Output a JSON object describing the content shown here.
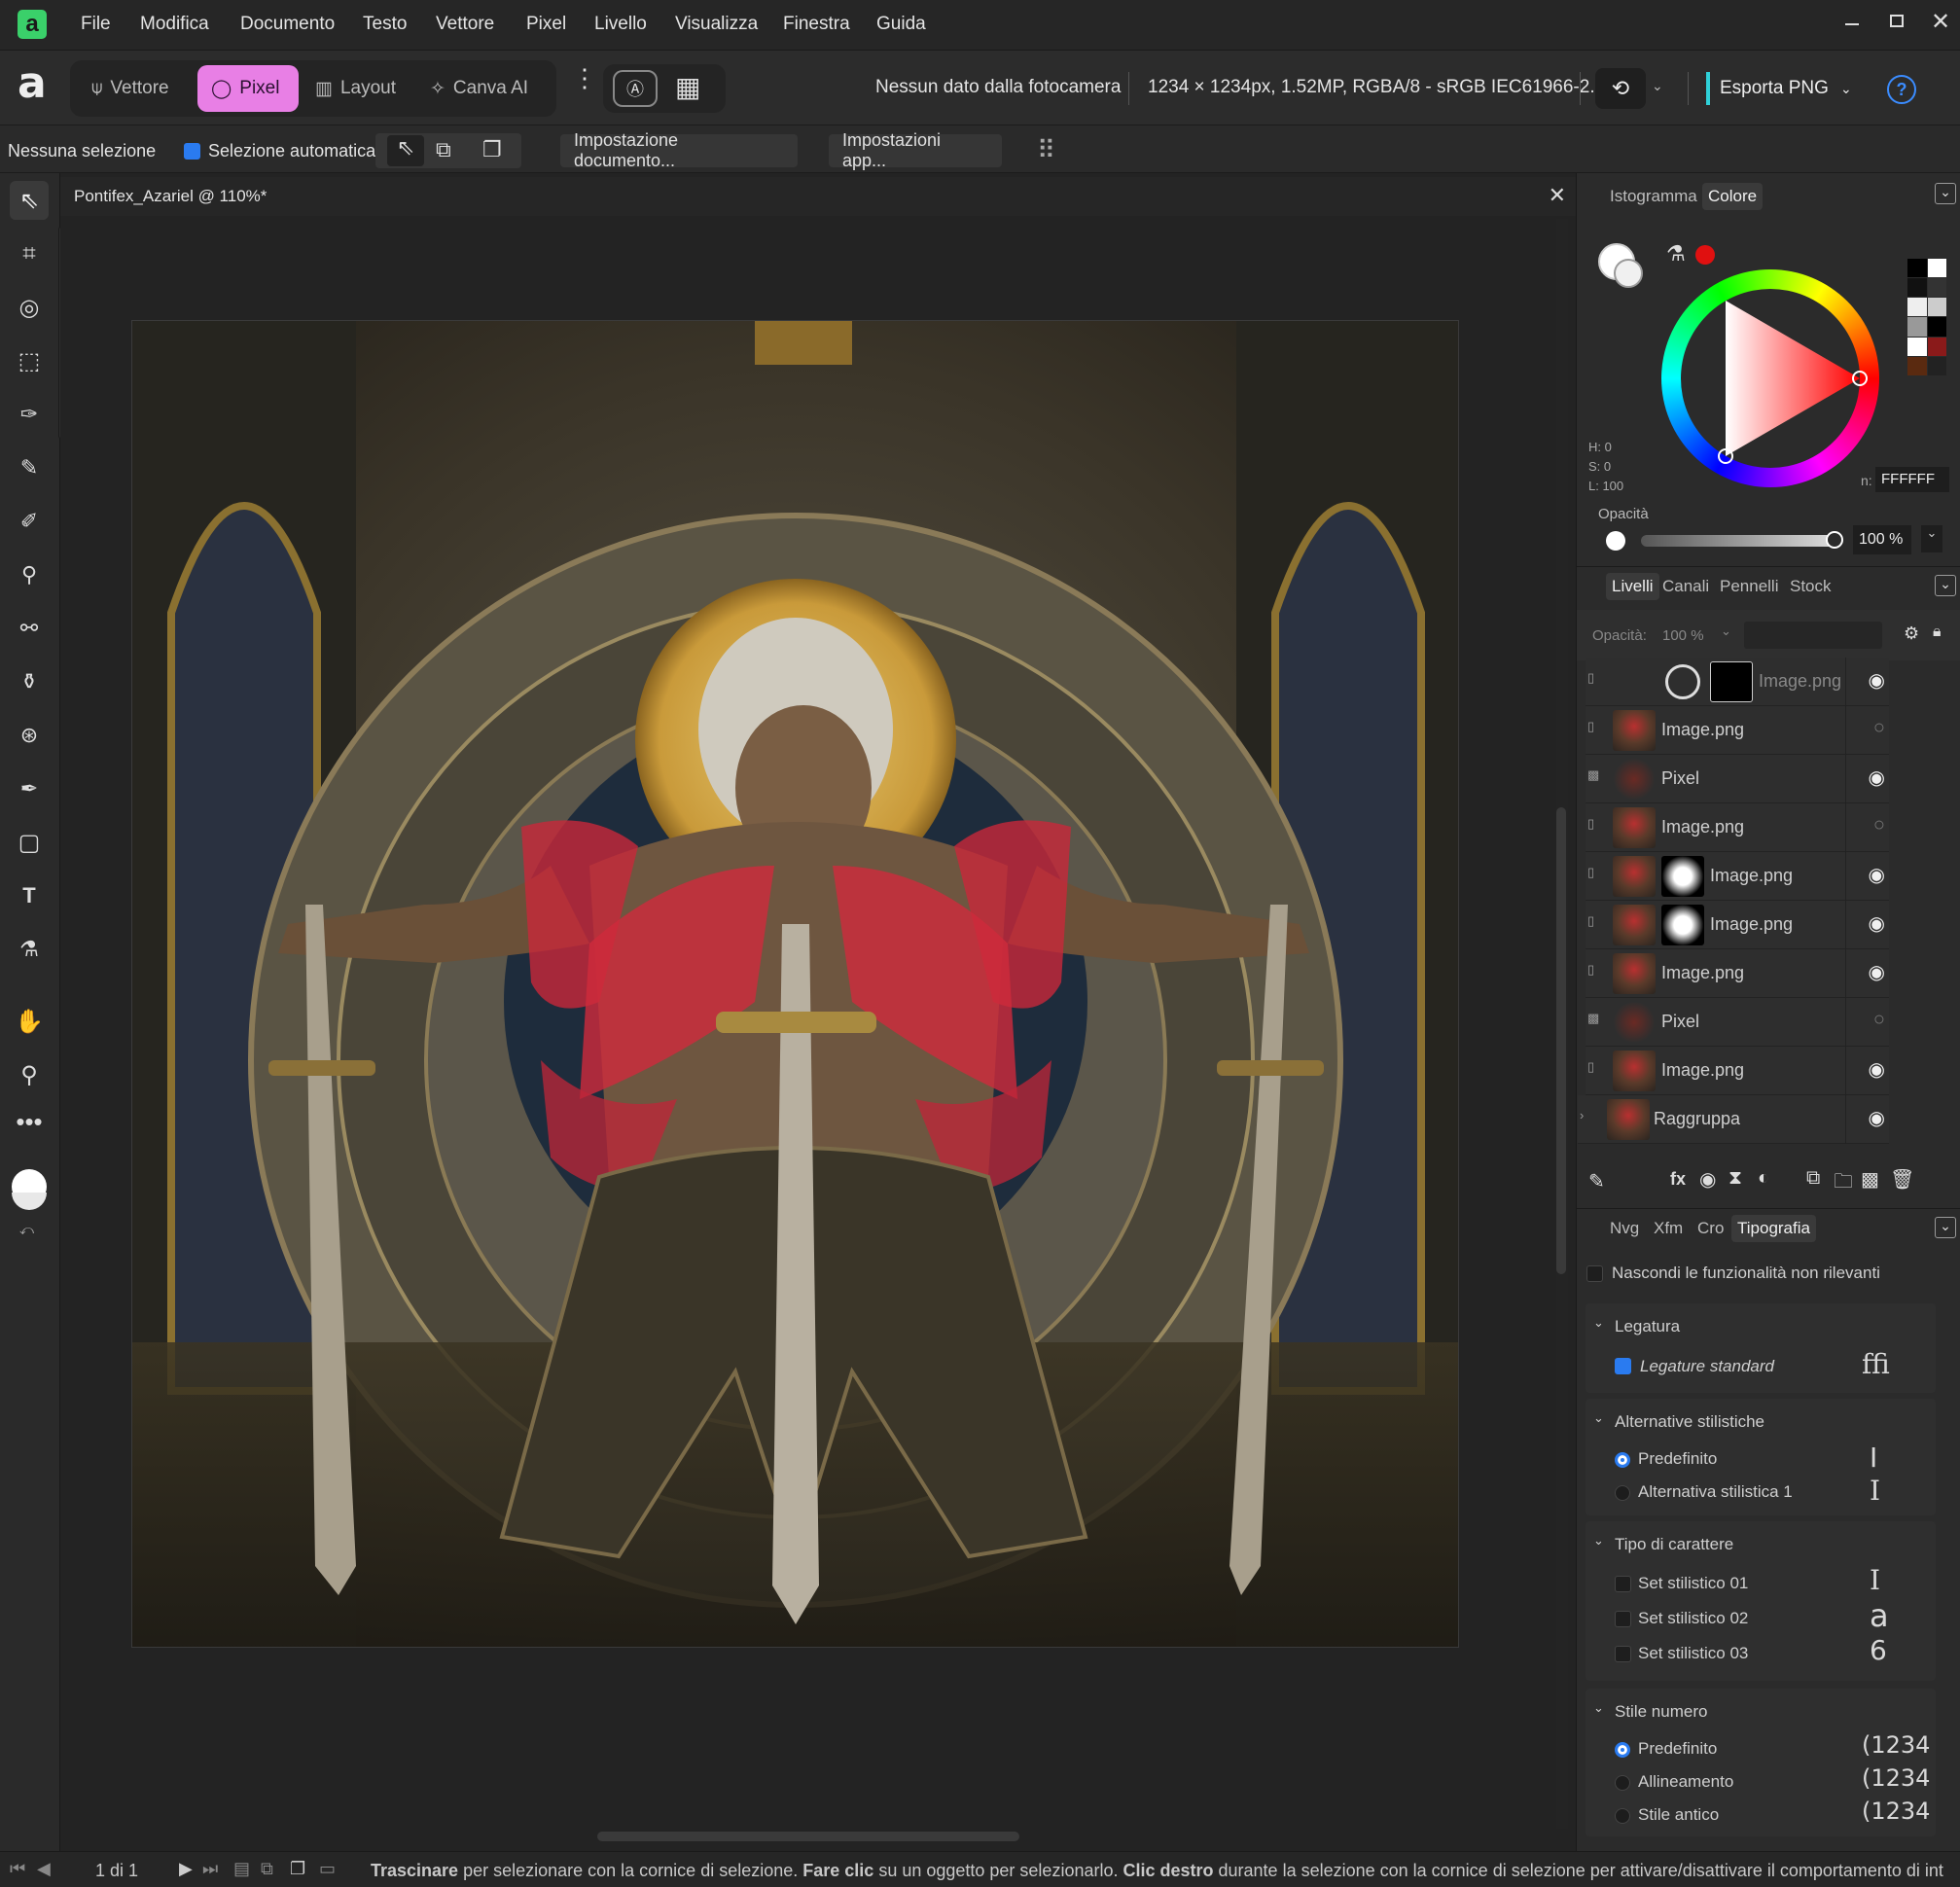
{
  "menubar": {
    "logo": "a",
    "items": [
      "File",
      "Modifica",
      "Documento",
      "Testo",
      "Vettore",
      "Pixel",
      "Livello",
      "Visualizza",
      "Finestra",
      "Guida"
    ]
  },
  "toolbar": {
    "personas": [
      {
        "label": "Vettore",
        "icon": "vector-icon"
      },
      {
        "label": "Pixel",
        "icon": "pixel-icon",
        "active": true
      },
      {
        "label": "Layout",
        "icon": "layout-icon"
      },
      {
        "label": "Canva AI",
        "icon": "sparkle-icon"
      }
    ],
    "camera_info": "Nessun dato dalla fotocamera",
    "doc_info": "1234 × 1234px, 1.52MP, RGBA/8 - sRGB IEC61966-2.1",
    "export_label": "Esporta PNG",
    "accent": "#e87fe5"
  },
  "context": {
    "selection": "Nessuna selezione",
    "auto_select_label": "Selezione automatica:",
    "doc_setup": "Impostazione documento...",
    "app_settings": "Impostazioni app..."
  },
  "document": {
    "tab_title": "Pontifex_Azariel @ 110%*"
  },
  "color_panel": {
    "tabs": [
      "Istogramma",
      "Colore"
    ],
    "h": "H: 0",
    "s": "S: 0",
    "l": "L: 100",
    "hex_label": "n:",
    "hex": "FFFFFF",
    "opacity_label": "Opacità",
    "opacity_value": "100 %"
  },
  "layers_panel": {
    "tabs": [
      "Livelli",
      "Canali",
      "Pennelli",
      "Stock"
    ],
    "opacity_label": "Opacità:",
    "opacity_value": "100 %",
    "layers": [
      {
        "name": "Image.png",
        "type": "adjust",
        "visible": true
      },
      {
        "name": "Image.png",
        "type": "image",
        "visible": false
      },
      {
        "name": "Pixel",
        "type": "pixel",
        "visible": true
      },
      {
        "name": "Image.png",
        "type": "image",
        "visible": false
      },
      {
        "name": "Image.png",
        "type": "mask",
        "visible": true
      },
      {
        "name": "Image.png",
        "type": "mask",
        "visible": true
      },
      {
        "name": "Image.png",
        "type": "image",
        "visible": true
      },
      {
        "name": "Pixel",
        "type": "pixel",
        "visible": false
      },
      {
        "name": "Image.png",
        "type": "image",
        "visible": true
      },
      {
        "name": "Raggruppa",
        "type": "group",
        "visible": true
      }
    ]
  },
  "typography_panel": {
    "tabs": [
      "Nvg",
      "Xfm",
      "Cro",
      "Tipografia"
    ],
    "hide_label": "Nascondi le funzionalità non rilevanti",
    "ligature": {
      "title": "Legatura",
      "option": "Legature standard",
      "glyph": "ﬃ"
    },
    "stylistic": {
      "title": "Alternative stilistiche",
      "options": [
        "Predefinito",
        "Alternativa stilistica 1"
      ],
      "glyphs": [
        "I",
        "I"
      ]
    },
    "charset": {
      "title": "Tipo di carattere",
      "options": [
        "Set stilistico 01",
        "Set stilistico 02",
        "Set stilistico 03"
      ],
      "glyphs": [
        "I",
        "a",
        "6"
      ]
    },
    "numstyle": {
      "title": "Stile numero",
      "options": [
        "Predefinito",
        "Allineamento",
        "Stile antico"
      ],
      "glyphs": [
        "(1234",
        "(1234",
        "(1234"
      ]
    }
  },
  "status": {
    "page": "1 di 1",
    "drag": "Trascinare",
    "t1": " per selezionare con la cornice di selezione. ",
    "click": "Fare clic",
    "t2": " su un oggetto per selezionarlo. ",
    "rclick": "Clic destro",
    "t3": " durante la selezione con la cornice di selezione per attivare/disattivare il comportamento di int"
  }
}
